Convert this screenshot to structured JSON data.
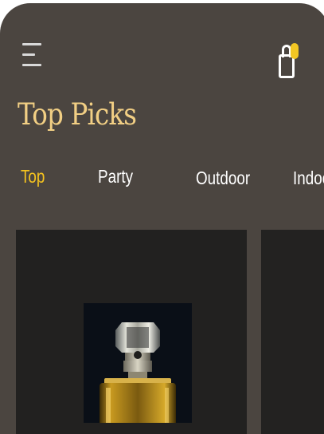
{
  "header": {
    "menu_icon": "hamburger-menu-icon",
    "bag_icon": "shopping-bag-icon",
    "bag_badge_color": "#f3c623"
  },
  "title": "Top Picks",
  "tabs": [
    {
      "label": "Top",
      "active": true
    },
    {
      "label": "Party",
      "active": false
    },
    {
      "label": "Outdoor",
      "active": false
    },
    {
      "label": "Indoor",
      "active": false
    }
  ],
  "colors": {
    "background": "#4b4540",
    "title": "#f2cf84",
    "active_tab": "#f4c21f",
    "card": "#222120"
  },
  "products": [
    {
      "image": "perfume-bottle-image"
    },
    {
      "image": ""
    }
  ]
}
